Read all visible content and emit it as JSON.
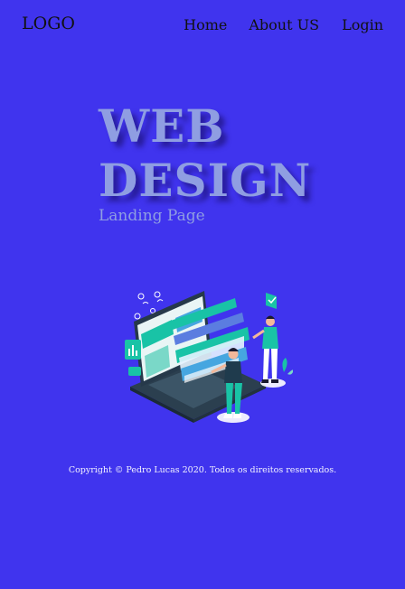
{
  "header": {
    "logo": "LOGO",
    "nav": [
      "Home",
      "About US",
      "Login"
    ]
  },
  "hero": {
    "title_line1": "WEB",
    "title_line2": "DESIGN",
    "subtitle": "Landing Page"
  },
  "illustration": {
    "icon": "web-design-illustration-icon"
  },
  "footer": {
    "copyright": "Copyright © Pedro Lucas 2020. Todos os direitos reservados."
  },
  "colors": {
    "background": "#4034ee",
    "title": "#8f9ee2",
    "accent": "#19c3a6"
  }
}
